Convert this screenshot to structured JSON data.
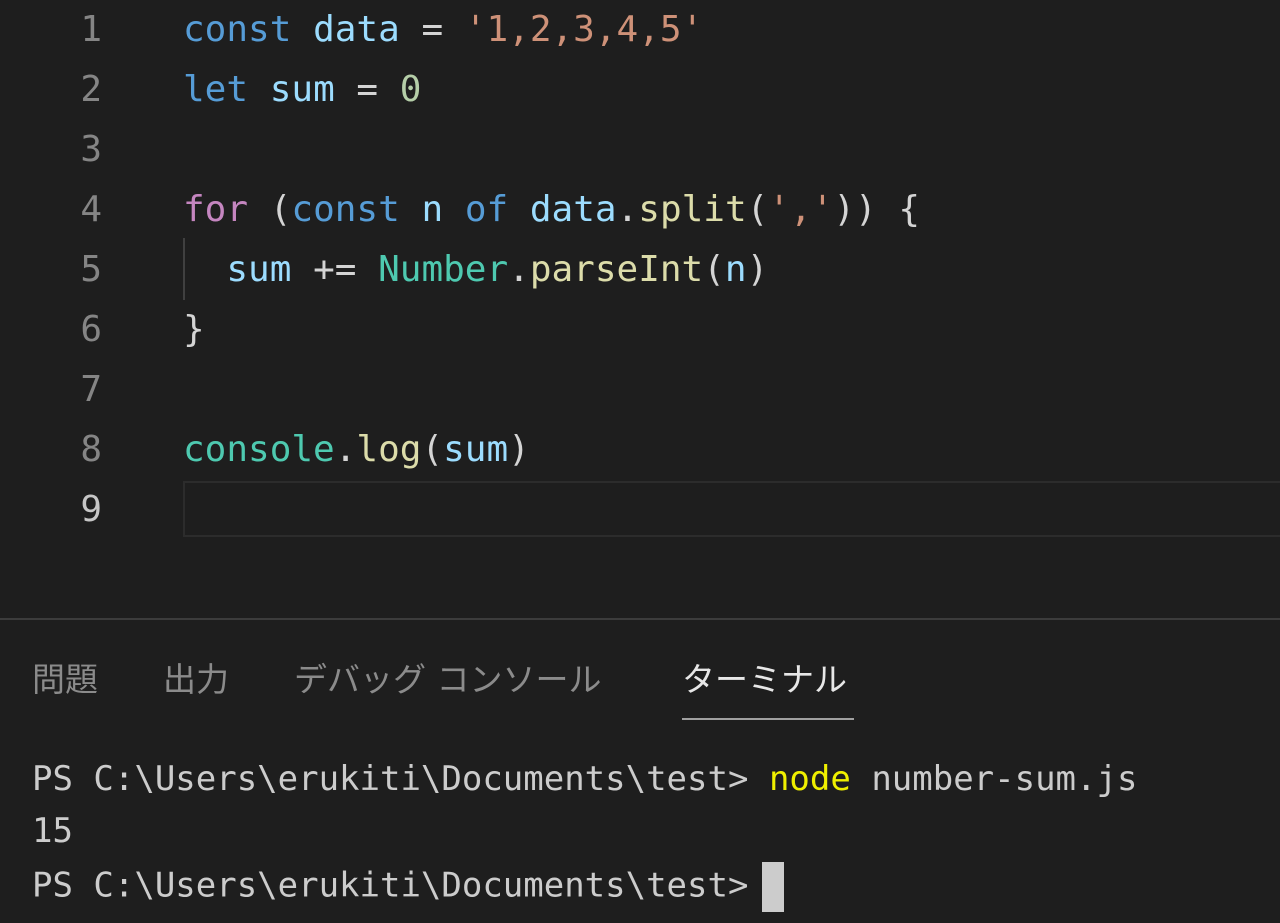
{
  "editor": {
    "lines": [
      {
        "num": "1",
        "tokens": [
          "const",
          " ",
          "data",
          " = ",
          "'1,2,3,4,5'"
        ]
      },
      {
        "num": "2",
        "tokens": [
          "let",
          " ",
          "sum",
          " = ",
          "0"
        ]
      },
      {
        "num": "3"
      },
      {
        "num": "4",
        "tokens": [
          "for",
          " (",
          "const",
          " ",
          "n",
          " ",
          "of",
          " ",
          "data",
          ".",
          "split",
          "(",
          "','",
          ")) {"
        ]
      },
      {
        "num": "5",
        "tokens": [
          "  ",
          "sum",
          " += ",
          "Number",
          ".",
          "parseInt",
          "(",
          "n",
          ")"
        ]
      },
      {
        "num": "6",
        "tokens": [
          "}"
        ]
      },
      {
        "num": "7"
      },
      {
        "num": "8",
        "tokens": [
          "console",
          ".",
          "log",
          "(",
          "sum",
          ")"
        ]
      },
      {
        "num": "9"
      }
    ]
  },
  "panel": {
    "tabs": [
      "問題",
      "出力",
      "デバッグ コンソール",
      "ターミナル"
    ],
    "active_tab": "ターミナル",
    "terminal": {
      "prompt": "PS C:\\Users\\erukiti\\Documents\\test>",
      "command_name": "node",
      "command_arg": "number-sum.js",
      "output": "15"
    }
  },
  "colors": {
    "background": "#1e1e1e",
    "keyword": "#569cd6",
    "control_keyword": "#c586c0",
    "variable": "#9cdcfe",
    "string": "#ce9178",
    "number": "#b5cea8",
    "function": "#dcdcaa",
    "class": "#4ec9b0",
    "terminal_command": "#f0f000"
  }
}
